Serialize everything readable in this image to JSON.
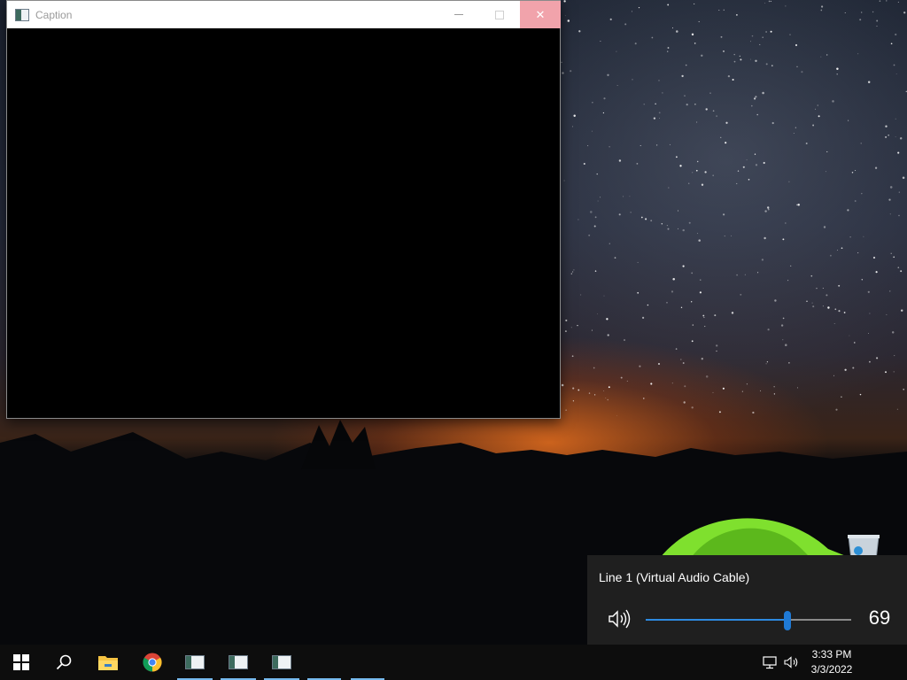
{
  "window": {
    "title": "Caption",
    "icon": "app-window-icon",
    "buttons": [
      "minimize-icon",
      "maximize-icon",
      "close-icon"
    ]
  },
  "desktop": {
    "icons": [
      "recycle-bin-icon"
    ]
  },
  "volume_flyout": {
    "device_name": "Line 1 (Virtual Audio Cable)",
    "volume": 69,
    "volume_label": "69",
    "accent_color": "#1f7ad6"
  },
  "taskbar": {
    "items": [
      {
        "icon": "windows-start-icon",
        "running": false
      },
      {
        "icon": "search-icon",
        "running": false
      },
      {
        "icon": "file-explorer-icon",
        "running": false
      },
      {
        "icon": "chrome-icon",
        "running": false
      },
      {
        "icon": "app-window-icon",
        "running": true
      },
      {
        "icon": "app-window-icon",
        "running": true
      },
      {
        "icon": "app-window-icon",
        "running": true
      }
    ],
    "tray_icons": [
      "network-icon",
      "speaker-icon"
    ],
    "clock": {
      "time": "3:33 PM",
      "date": "3/3/2022"
    }
  }
}
